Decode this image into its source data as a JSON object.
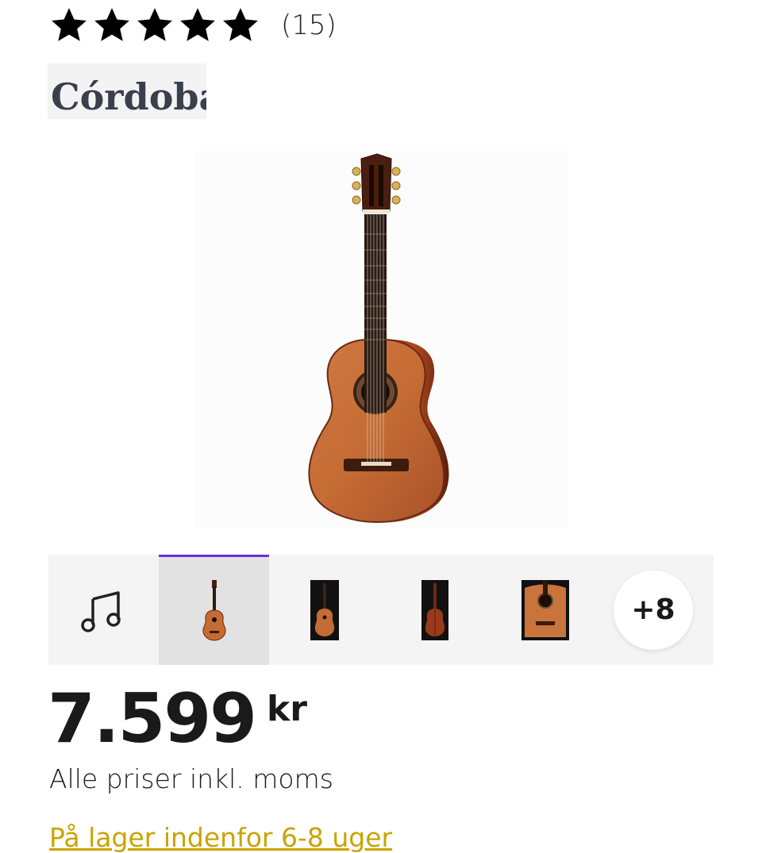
{
  "rating": {
    "stars_filled": 5,
    "stars_total": 5,
    "review_count": "(15)"
  },
  "brand": {
    "logo_text": "Córdoba"
  },
  "thumbnails": {
    "audio_icon": "music-note-icon",
    "items": [
      "guitar-front",
      "guitar-front-dark",
      "guitar-back-dark",
      "guitar-body-closeup"
    ],
    "more_label": "+8",
    "active_index": 0,
    "accent_color": "#6a2ee0"
  },
  "price": {
    "amount": "7.599",
    "currency": "kr",
    "vat_note": "Alle priser inkl. moms"
  },
  "availability": {
    "status": "På lager indenfor 6-8 uger",
    "color": "#c9a400"
  }
}
